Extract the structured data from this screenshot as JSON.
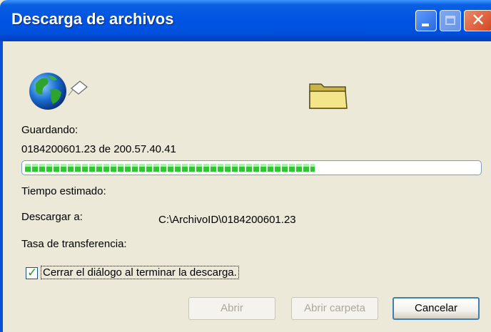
{
  "window": {
    "title": "Descarga de archivos",
    "controls": [
      "minimize-icon",
      "maximize-icon",
      "close-icon"
    ]
  },
  "icons": {
    "source": "globe-with-document-icon",
    "destination": "folder-icon"
  },
  "status": {
    "saving_label": "Guardando:",
    "saving_value": "0184200601.23 de 200.57.40.41",
    "progress_fraction": 0.64,
    "estimated_time_label": "Tiempo estimado:",
    "download_to_label": "Descargar a:",
    "download_to_value": "C:\\ArchivoID\\0184200601.23",
    "transfer_rate_label": "Tasa de transferencia:"
  },
  "options": {
    "close_on_finish_label": "Cerrar el diálogo al terminar la descarga.",
    "close_on_finish_checked": true
  },
  "buttons": {
    "open": "Abrir",
    "open_folder": "Abrir carpeta",
    "cancel": "Cancelar"
  },
  "colors": {
    "titlebar": "#0054e3",
    "progress": "#2fc72f",
    "dialog_bg": "#ece9d8"
  }
}
